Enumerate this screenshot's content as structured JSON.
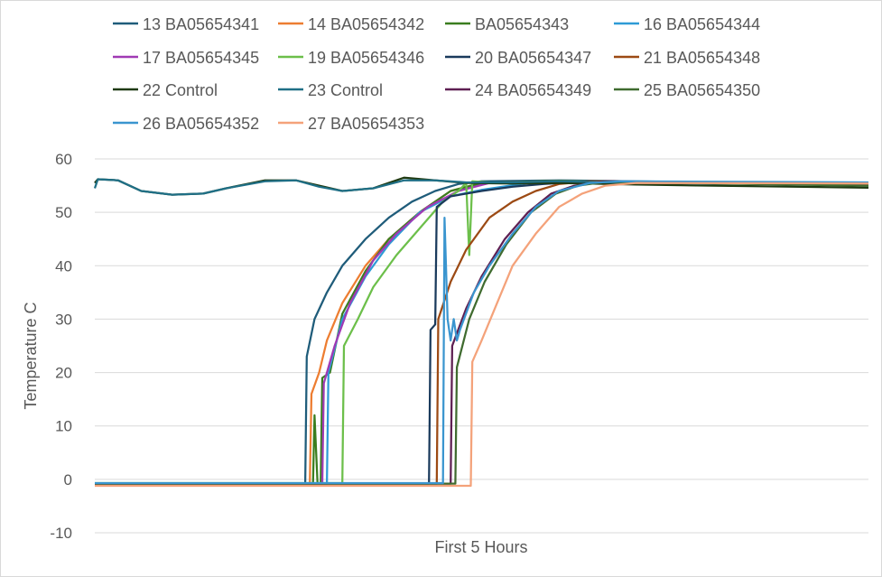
{
  "chart_data": {
    "type": "line",
    "xlabel": "First 5 Hours",
    "ylabel": "Temperature C",
    "ylim": [
      -10,
      60
    ],
    "yticks": [
      -10,
      0,
      10,
      20,
      30,
      40,
      50,
      60
    ],
    "xlim": [
      0,
      5
    ],
    "grid": "horizontal",
    "legend_position": "top",
    "series": [
      {
        "name": "13 BA05654341",
        "color": "#1f5c7a",
        "points": [
          [
            0,
            -0.8
          ],
          [
            1.36,
            -0.8
          ],
          [
            1.37,
            23
          ],
          [
            1.42,
            30
          ],
          [
            1.5,
            35
          ],
          [
            1.6,
            40
          ],
          [
            1.75,
            45
          ],
          [
            1.9,
            49
          ],
          [
            2.05,
            52
          ],
          [
            2.2,
            54
          ],
          [
            2.35,
            55.3
          ],
          [
            2.5,
            55.8
          ],
          [
            3,
            56
          ],
          [
            5,
            55.2
          ]
        ]
      },
      {
        "name": "14 BA05654342",
        "color": "#ed7d31",
        "points": [
          [
            0,
            -0.8
          ],
          [
            1.39,
            -0.8
          ],
          [
            1.4,
            16
          ],
          [
            1.45,
            20
          ],
          [
            1.5,
            26
          ],
          [
            1.6,
            33
          ],
          [
            1.75,
            40
          ],
          [
            1.9,
            45
          ],
          [
            2.1,
            50
          ],
          [
            2.3,
            54
          ],
          [
            2.5,
            55.5
          ],
          [
            3,
            55.8
          ],
          [
            5,
            55.3
          ]
        ]
      },
      {
        "name": "BA05654343",
        "color": "#3a7d1f",
        "points": [
          [
            0,
            -1
          ],
          [
            1.41,
            -1
          ],
          [
            1.42,
            12
          ],
          [
            1.44,
            -1
          ],
          [
            1.46,
            -1
          ],
          [
            1.47,
            19
          ],
          [
            1.52,
            20
          ],
          [
            1.6,
            31
          ],
          [
            1.75,
            39
          ],
          [
            1.9,
            45
          ],
          [
            2.1,
            50
          ],
          [
            2.3,
            54
          ],
          [
            2.5,
            55.5
          ],
          [
            3,
            55.9
          ],
          [
            5,
            55
          ]
        ]
      },
      {
        "name": "16 BA05654344",
        "color": "#2e9bd6",
        "points": [
          [
            0,
            -0.9
          ],
          [
            1.5,
            -0.9
          ],
          [
            1.51,
            20
          ],
          [
            1.6,
            30
          ],
          [
            1.75,
            38
          ],
          [
            1.9,
            44
          ],
          [
            2.1,
            50
          ],
          [
            2.3,
            53
          ],
          [
            2.5,
            54.2
          ],
          [
            2.8,
            55.5
          ],
          [
            3,
            55.8
          ],
          [
            5,
            55.4
          ]
        ]
      },
      {
        "name": "17 BA05654345",
        "color": "#a03ab4",
        "points": [
          [
            0,
            -0.9
          ],
          [
            1.47,
            -0.9
          ],
          [
            1.48,
            18
          ],
          [
            1.55,
            25
          ],
          [
            1.65,
            33
          ],
          [
            1.8,
            41
          ],
          [
            1.95,
            46
          ],
          [
            2.15,
            51
          ],
          [
            2.35,
            54
          ],
          [
            2.55,
            55.5
          ],
          [
            3,
            55.8
          ],
          [
            5,
            55.3
          ]
        ]
      },
      {
        "name": "19 BA05654346",
        "color": "#6cbf4a",
        "points": [
          [
            0,
            -0.7
          ],
          [
            1.6,
            -0.7
          ],
          [
            1.61,
            25
          ],
          [
            1.7,
            30
          ],
          [
            1.8,
            36
          ],
          [
            1.95,
            42
          ],
          [
            2.1,
            47
          ],
          [
            2.25,
            52
          ],
          [
            2.35,
            54
          ],
          [
            2.4,
            55.5
          ],
          [
            2.42,
            42
          ],
          [
            2.44,
            55.8
          ],
          [
            2.6,
            55.5
          ],
          [
            3,
            55.8
          ],
          [
            5,
            55.3
          ]
        ]
      },
      {
        "name": "20 BA05654347",
        "color": "#1a3a5c",
        "points": [
          [
            0,
            -0.8
          ],
          [
            2.16,
            -0.8
          ],
          [
            2.17,
            28
          ],
          [
            2.2,
            29
          ],
          [
            2.21,
            51
          ],
          [
            2.3,
            53
          ],
          [
            2.5,
            54
          ],
          [
            2.7,
            54.8
          ],
          [
            2.9,
            55.3
          ],
          [
            3.2,
            55.8
          ],
          [
            5,
            55.2
          ]
        ]
      },
      {
        "name": "21 BA05654348",
        "color": "#9c4a14",
        "points": [
          [
            0,
            -0.8
          ],
          [
            2.21,
            -0.8
          ],
          [
            2.22,
            30
          ],
          [
            2.3,
            37
          ],
          [
            2.4,
            43
          ],
          [
            2.55,
            49
          ],
          [
            2.7,
            52
          ],
          [
            2.85,
            54
          ],
          [
            3,
            55.3
          ],
          [
            3.2,
            55.8
          ],
          [
            5,
            55.1
          ]
        ]
      },
      {
        "name": "22 Control",
        "color": "#1f3a12",
        "points": [
          [
            0,
            55.5
          ],
          [
            0.02,
            56.2
          ],
          [
            0.15,
            56
          ],
          [
            0.3,
            54
          ],
          [
            0.5,
            53.3
          ],
          [
            0.7,
            53.5
          ],
          [
            0.85,
            54.5
          ],
          [
            1.1,
            56
          ],
          [
            1.3,
            56
          ],
          [
            1.45,
            55
          ],
          [
            1.6,
            54
          ],
          [
            1.8,
            54.5
          ],
          [
            2,
            56.5
          ],
          [
            2.2,
            56
          ],
          [
            2.4,
            55.5
          ],
          [
            2.7,
            55.4
          ],
          [
            3,
            55.5
          ],
          [
            3.5,
            55.2
          ],
          [
            4,
            55
          ],
          [
            5,
            54.6
          ]
        ]
      },
      {
        "name": "23 Control",
        "color": "#1f6f86",
        "points": [
          [
            0,
            54.5
          ],
          [
            0.02,
            56.2
          ],
          [
            0.15,
            56
          ],
          [
            0.3,
            54
          ],
          [
            0.5,
            53.3
          ],
          [
            0.7,
            53.5
          ],
          [
            0.85,
            54.5
          ],
          [
            1.1,
            55.8
          ],
          [
            1.3,
            56
          ],
          [
            1.45,
            54.8
          ],
          [
            1.6,
            54
          ],
          [
            1.8,
            54.5
          ],
          [
            2,
            56
          ],
          [
            2.2,
            56
          ],
          [
            2.4,
            55.6
          ],
          [
            2.7,
            55.6
          ],
          [
            3,
            55.8
          ],
          [
            3.5,
            55.5
          ],
          [
            4,
            55.4
          ],
          [
            5,
            55.4
          ]
        ]
      },
      {
        "name": "24 BA05654349",
        "color": "#5e1f52",
        "points": [
          [
            0,
            -0.8
          ],
          [
            2.3,
            -0.8
          ],
          [
            2.31,
            25
          ],
          [
            2.4,
            32
          ],
          [
            2.5,
            38
          ],
          [
            2.65,
            45
          ],
          [
            2.8,
            50
          ],
          [
            2.95,
            53.5
          ],
          [
            3.1,
            55
          ],
          [
            3.3,
            55.8
          ],
          [
            5,
            55.3
          ]
        ]
      },
      {
        "name": "25 BA05654350",
        "color": "#3f6b2f",
        "points": [
          [
            0,
            -0.8
          ],
          [
            2.33,
            -0.8
          ],
          [
            2.34,
            21
          ],
          [
            2.42,
            30
          ],
          [
            2.52,
            37
          ],
          [
            2.66,
            44
          ],
          [
            2.82,
            50
          ],
          [
            2.98,
            53.5
          ],
          [
            3.12,
            55
          ],
          [
            3.3,
            55.7
          ],
          [
            5,
            55
          ]
        ]
      },
      {
        "name": "26 BA05654352",
        "color": "#3a95cf",
        "points": [
          [
            0,
            -0.7
          ],
          [
            2.25,
            -0.7
          ],
          [
            2.26,
            49
          ],
          [
            2.28,
            30
          ],
          [
            2.3,
            26
          ],
          [
            2.32,
            30
          ],
          [
            2.34,
            26
          ],
          [
            2.36,
            28
          ],
          [
            2.45,
            35
          ],
          [
            2.55,
            40
          ],
          [
            2.7,
            46
          ],
          [
            2.85,
            51
          ],
          [
            3,
            54
          ],
          [
            3.2,
            55.5
          ],
          [
            3.4,
            55.8
          ],
          [
            5,
            55.6
          ]
        ]
      },
      {
        "name": "27 BA05654353",
        "color": "#f4a27a",
        "points": [
          [
            0,
            -1.2
          ],
          [
            2.43,
            -1.2
          ],
          [
            2.44,
            22
          ],
          [
            2.5,
            26
          ],
          [
            2.6,
            33
          ],
          [
            2.7,
            40
          ],
          [
            2.85,
            46
          ],
          [
            3,
            51
          ],
          [
            3.15,
            53.5
          ],
          [
            3.3,
            55
          ],
          [
            3.5,
            55.5
          ],
          [
            5,
            55.4
          ]
        ]
      }
    ]
  }
}
